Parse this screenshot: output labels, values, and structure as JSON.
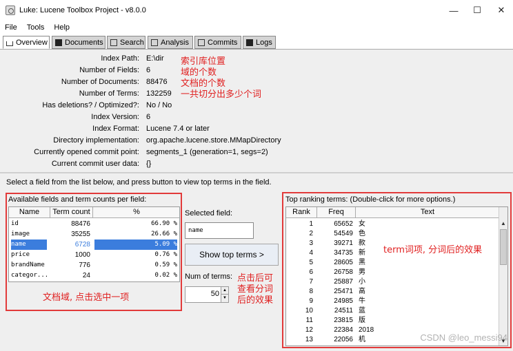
{
  "window": {
    "title": "Luke: Lucene Toolbox Project - v8.0.0",
    "min_glyph": "—",
    "max_glyph": "☐",
    "close_glyph": "✕"
  },
  "menu": [
    "File",
    "Tools",
    "Help"
  ],
  "tabs": [
    "Overview",
    "Documents",
    "Search",
    "Analysis",
    "Commits",
    "Logs"
  ],
  "overview": {
    "rows": [
      {
        "label": "Index Path:",
        "value": "E:\\dir"
      },
      {
        "label": "Number of Fields:",
        "value": "6"
      },
      {
        "label": "Number of Documents:",
        "value": "88476"
      },
      {
        "label": "Number of Terms:",
        "value": "132259"
      },
      {
        "label": "Has deletions? / Optimized?:",
        "value": "No / No"
      },
      {
        "label": "Index Version:",
        "value": "6"
      },
      {
        "label": "Index Format:",
        "value": "Lucene 7.4 or later"
      },
      {
        "label": "Directory implementation:",
        "value": "org.apache.lucene.store.MMapDirectory"
      },
      {
        "label": "Currently opened commit point:",
        "value": "segments_1 (generation=1, segs=2)"
      },
      {
        "label": "Current commit user data:",
        "value": "{}"
      }
    ],
    "annotations": [
      "索引库位置",
      "域的个数",
      "文档的个数",
      "一共切分出多少个词"
    ]
  },
  "instruction": "Select a field from the list below, and press button to view top terms in the field.",
  "fields_panel": {
    "title": "Available fields and term counts per field:",
    "headers": [
      "Name",
      "Term count",
      "%"
    ],
    "rows": [
      {
        "name": "id",
        "count": "88476",
        "pct": "66.90 %"
      },
      {
        "name": "image",
        "count": "35255",
        "pct": "26.66 %"
      },
      {
        "name": "name",
        "count": "6728",
        "pct": "5.09 %"
      },
      {
        "name": "price",
        "count": "1000",
        "pct": "0.76 %"
      },
      {
        "name": "brandName",
        "count": "776",
        "pct": "0.59 %"
      },
      {
        "name": "categor...",
        "count": "24",
        "pct": "0.02 %"
      }
    ],
    "annotation": "文档域, 点击选中一项"
  },
  "middle": {
    "selected_label": "Selected field:",
    "selected_value": "name",
    "button": "Show top terms >",
    "num_label": "Num of terms:",
    "num_value": "50",
    "annotation": [
      "点击后可",
      "查看分词",
      "后的效果"
    ]
  },
  "terms_panel": {
    "title": "Top ranking terms: (Double-click for more options.)",
    "headers": [
      "Rank",
      "Freq",
      "Text"
    ],
    "rows": [
      {
        "rank": "1",
        "freq": "65652",
        "text": "女"
      },
      {
        "rank": "2",
        "freq": "54549",
        "text": "色"
      },
      {
        "rank": "3",
        "freq": "39271",
        "text": "款"
      },
      {
        "rank": "4",
        "freq": "34735",
        "text": "新"
      },
      {
        "rank": "5",
        "freq": "28605",
        "text": "黑"
      },
      {
        "rank": "6",
        "freq": "26758",
        "text": "男"
      },
      {
        "rank": "7",
        "freq": "25887",
        "text": "小"
      },
      {
        "rank": "8",
        "freq": "25471",
        "text": "高"
      },
      {
        "rank": "9",
        "freq": "24985",
        "text": "牛"
      },
      {
        "rank": "10",
        "freq": "24511",
        "text": "蓝"
      },
      {
        "rank": "11",
        "freq": "23815",
        "text": "版"
      },
      {
        "rank": "12",
        "freq": "22384",
        "text": "2018"
      },
      {
        "rank": "13",
        "freq": "22056",
        "text": "机"
      }
    ],
    "annotation": "term词项, 分词后的效果"
  },
  "watermark": "CSDN @leo_messi94",
  "colors": {
    "annotation": "#e02020",
    "highlight_box": "#e23a3a",
    "selection": "#3b7ddd"
  }
}
